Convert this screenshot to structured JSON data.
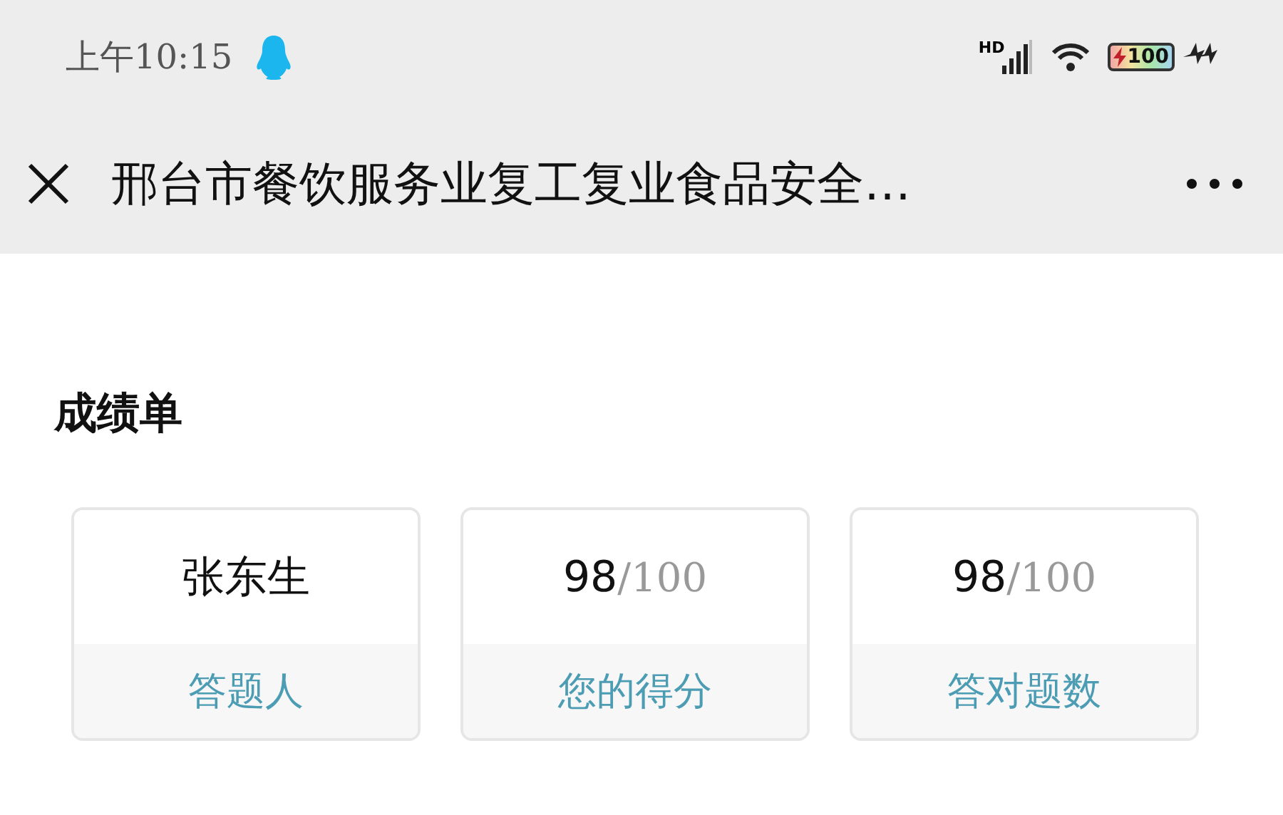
{
  "status_bar": {
    "time": "上午10:15",
    "network_label": "HD",
    "battery": "100"
  },
  "nav_bar": {
    "title": "邢台市餐饮服务业复工复业食品安全…"
  },
  "page": {
    "heading": "成绩单",
    "cards": [
      {
        "value": "张东生",
        "label": "答题人"
      },
      {
        "value": "98",
        "total": "/100",
        "label": "您的得分"
      },
      {
        "value": "98",
        "total": "/100",
        "label": "答对题数"
      }
    ]
  }
}
